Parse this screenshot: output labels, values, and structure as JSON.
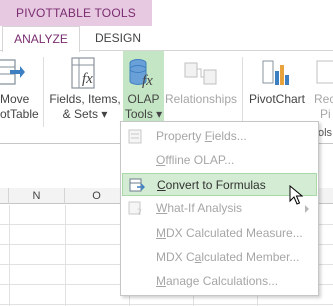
{
  "contextual": {
    "title": "PIVOTTABLE TOOLS",
    "accent": "#7a2d6f",
    "band_color": "#e7c9e2"
  },
  "tabs": {
    "analyze": "ANALYZE",
    "design": "DESIGN"
  },
  "ribbon": {
    "move_line1": "Move",
    "move_line2": "otTable",
    "fields_line1": "Fields, Items,",
    "fields_line2": "& Sets ▾",
    "olap_line1": "OLAP",
    "olap_line2": "Tools ▾",
    "relationships": "Relationships",
    "pivotchart": "PivotChart",
    "reco_line1": "Reco",
    "reco_line2": "Pi",
    "group_frag_ca": "Ca",
    "group_frag_ols": "ols",
    "olap_highlight": "#c4e6c4"
  },
  "grid": {
    "col_n": "N",
    "col_o": "O"
  },
  "menu": {
    "items": [
      {
        "label": "Property Fields...",
        "mnemonic": "F",
        "enabled": false
      },
      {
        "label": "Offline OLAP...",
        "mnemonic": "O",
        "enabled": false
      },
      {
        "label": "Convert to Formulas",
        "mnemonic": "C",
        "enabled": true,
        "hovered": true
      },
      {
        "label": "What-If Analysis",
        "mnemonic": "W",
        "enabled": false,
        "submenu": true
      },
      {
        "label": "MDX Calculated Measure...",
        "mnemonic": "M",
        "enabled": false
      },
      {
        "label": "MDX Calculated Member...",
        "mnemonic": "a",
        "enabled": false
      },
      {
        "label": "Manage Calculations...",
        "mnemonic": "M",
        "enabled": false
      }
    ],
    "hover_color": "#d3ecd3"
  }
}
